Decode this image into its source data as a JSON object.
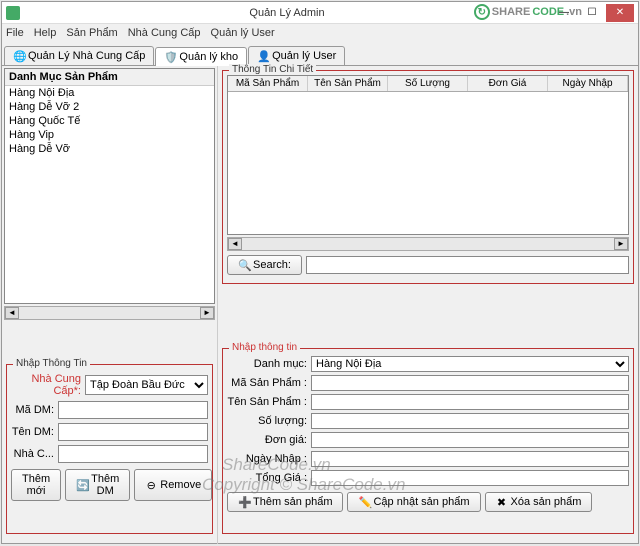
{
  "window": {
    "title": "Quản Lý Admin"
  },
  "menu": {
    "file": "File",
    "help": "Help",
    "sanpham": "Sản Phẩm",
    "nhacungcap": "Nhà Cung Cấp",
    "quanlyuser": "Quản lý User"
  },
  "logo": {
    "share": "SHARE",
    "code": "CODE",
    "dotvn": ".vn"
  },
  "tabs": {
    "t1": "Quản Lý Nhà Cung Cấp",
    "t2": "Quản lý kho",
    "t3": "Quản lý User"
  },
  "leftList": {
    "header": "Danh Mục Sản Phẩm",
    "items": [
      "Hàng Nội Địa",
      "Hàng Dễ Vỡ  2",
      "Hàng Quốc Tế",
      "Hàng Vip",
      "Hàng Dễ Vỡ"
    ]
  },
  "detail": {
    "legend": "Thông Tin Chi Tiết",
    "cols": [
      "Mã Sản Phẩm",
      "Tên Sản Phẩm",
      "Số Lượng",
      "Đơn Giá",
      "Ngày Nhập"
    ],
    "searchBtn": "Search:"
  },
  "leftForm": {
    "legend": "Nhập Thông Tin",
    "nhaCungCap": "Nhà Cung Cấp*:",
    "nhaCungCapVal": "Tập Đoàn Bầu Đức",
    "maDM": "Mã DM:",
    "tenDM": "Tên DM:",
    "nhaC": "Nhà C...",
    "btnThemMoi": "Thêm mới",
    "btnThemDM": "Thêm DM",
    "btnRemove": "Remove"
  },
  "rightForm": {
    "legend": "Nhập thông tin",
    "danhMuc": "Danh mục:",
    "danhMucVal": "Hàng Nội Địa",
    "maSP": "Mã Sản Phẩm :",
    "tenSP": "Tên Sản Phẩm :",
    "soLuong": "Số lượng:",
    "donGia": "Đơn giá:",
    "ngayNhap": "Ngày Nhập :",
    "tongGia": "Tổng Giá :",
    "btnThemSP": "Thêm sản phẩm",
    "btnCapNhat": "Cập nhật sản phẩm",
    "btnXoa": "Xóa sản phẩm"
  },
  "watermark": {
    "l1": "ShareCode.vn",
    "l2": "Copyright © ShareCode.vn"
  }
}
